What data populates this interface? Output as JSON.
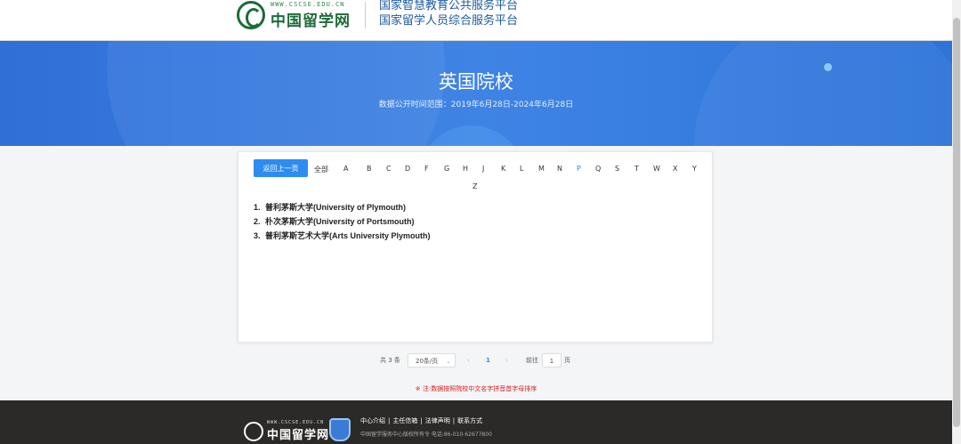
{
  "header": {
    "logo_url": "WWW.CSCSE.EDU.CN",
    "logo_name": "中国留学网",
    "platform_line1": "国家智慧教育公共服务平台",
    "platform_line2": "国家留学人员综合服务平台"
  },
  "banner": {
    "title": "英国院校",
    "subtitle": "数据公开时间范围：2019年6月28日-2024年6月28日"
  },
  "filter": {
    "back_label": "返回上一页",
    "all_label": "全部",
    "letters": [
      "A",
      "B",
      "C",
      "D",
      "F",
      "G",
      "H",
      "J",
      "K",
      "L",
      "M",
      "N",
      "P",
      "Q",
      "S",
      "T",
      "W",
      "X",
      "Y",
      "Z"
    ],
    "active_letter": "P"
  },
  "universities": [
    {
      "num": "1.",
      "name": "普利茅斯大学(University of Plymouth)"
    },
    {
      "num": "2.",
      "name": "朴次茅斯大学(University of Portsmouth)"
    },
    {
      "num": "3.",
      "name": "普利茅斯艺术大学(Arts University Plymouth)"
    }
  ],
  "pagination": {
    "total": "共 3 条",
    "page_size": "20条/页",
    "prev": "‹",
    "current": "1",
    "next": "›",
    "goto": "前往",
    "goto_value": "1",
    "page_unit": "页"
  },
  "note": "※ 注:数据按照院校中文名字拼音首字母排序",
  "footer": {
    "logo_url": "WWW.CSCSE.EDU.CN",
    "logo_name": "中国留学网",
    "links": [
      "中心介绍",
      "|",
      "主任信箱",
      "|",
      "法律声明",
      "|",
      "联系方式"
    ],
    "copyright": "中国留学服务中心版权所有令   电话:86-010-62677800"
  },
  "colors": {
    "accent": "#2d8cf0",
    "banner": "#3f84e5",
    "footer_bg": "#2b2a29",
    "note": "#e02020"
  }
}
